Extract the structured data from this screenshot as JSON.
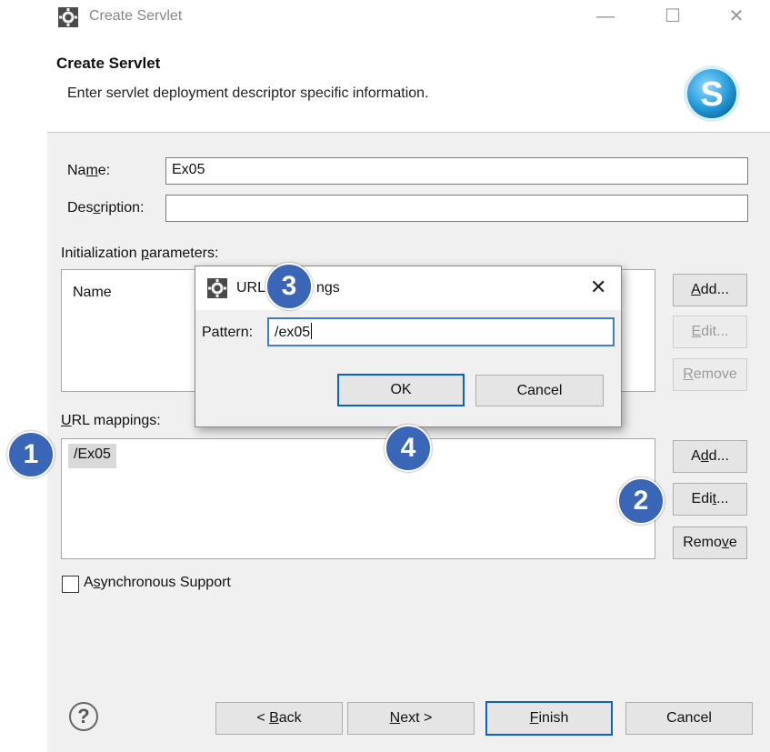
{
  "window": {
    "title": "Create Servlet"
  },
  "header": {
    "title": "Create Servlet",
    "description": "Enter servlet deployment descriptor specific information."
  },
  "form": {
    "name_label_pre": "Na",
    "name_label_key": "m",
    "name_label_post": "e:",
    "name_value": "Ex05",
    "description_label_pre": "Des",
    "description_label_key": "c",
    "description_label_post": "ription:",
    "description_value": ""
  },
  "init_params": {
    "label_pre": "Initialization ",
    "label_key": "p",
    "label_post": "arameters:",
    "column_name": "Name",
    "add_key": "A",
    "add_post": "dd...",
    "edit_key": "E",
    "edit_post": "dit...",
    "remove_key": "R",
    "remove_post": "emove"
  },
  "url_mappings": {
    "label_key": "U",
    "label_post": "RL mappings:",
    "items": [
      "/Ex05"
    ],
    "add_pre": "A",
    "add_key": "d",
    "add_post": "d...",
    "edit_pre": "Edi",
    "edit_key": "t",
    "edit_post": "...",
    "remove_pre": "Remo",
    "remove_key": "v",
    "remove_post": "e"
  },
  "async": {
    "label_pre": "A",
    "label_key": "s",
    "label_post": "ynchronous Support",
    "checked": false
  },
  "footer": {
    "help": "?",
    "back_pre": "< ",
    "back_key": "B",
    "back_post": "ack",
    "next_key": "N",
    "next_post": "ext >",
    "finish_key": "F",
    "finish_post": "inish",
    "cancel": "Cancel"
  },
  "dialog": {
    "title_visible_a": "URL",
    "title_visible_b": "ngs",
    "pattern_label": "Pattern:",
    "pattern_value": "/ex05",
    "ok": "OK",
    "cancel": "Cancel",
    "close": "✕"
  },
  "badges": [
    "1",
    "2",
    "3",
    "4"
  ],
  "colors": {
    "badge": "#3a66b8",
    "primary_border": "#0a64c8",
    "dialog_input_border": "#3c7fd0",
    "logo": "#2aa0dc"
  }
}
